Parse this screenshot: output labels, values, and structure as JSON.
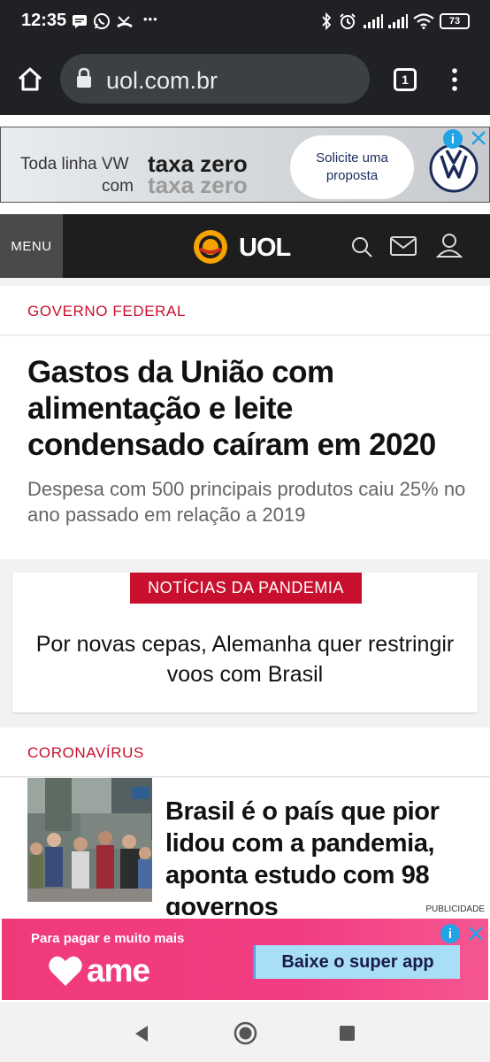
{
  "status_bar": {
    "time": "12:35",
    "more_dots": "•••",
    "battery": "73"
  },
  "browser": {
    "url": "uol.com.br",
    "tab_count": "1"
  },
  "ad_top": {
    "line1": "Toda linha VW",
    "bold1": "taxa zero",
    "line2": "com",
    "bold2": "taxa zero",
    "cta": "Solicite uma proposta"
  },
  "header": {
    "menu_label": "MENU",
    "logo_text": "UOL"
  },
  "article_main": {
    "kicker": "GOVERNO FEDERAL",
    "headline": "Gastos da União com alimentação e leite condensado caíram em 2020",
    "subheadline": "Despesa com 500 principais produtos caiu 25% no ano passado em relação a 2019"
  },
  "pandemic": {
    "tag": "NOTÍCIAS DA PANDEMIA",
    "headline": "Por novas cepas, Alemanha quer restringir voos com Brasil"
  },
  "article_corona": {
    "kicker": "CORONAVÍRUS",
    "headline": "Brasil é o país que pior lidou com a pandemia, aponta estudo com 98 governos"
  },
  "ad_bottom": {
    "label": "PUBLICIDADE",
    "line1": "Para pagar e muito mais",
    "brand": "ame",
    "cta": "Baixe o super app"
  },
  "colors": {
    "accent_red": "#c8102e",
    "dark_header": "#1e1e1e",
    "ad_pink": "#ef3a7a"
  }
}
